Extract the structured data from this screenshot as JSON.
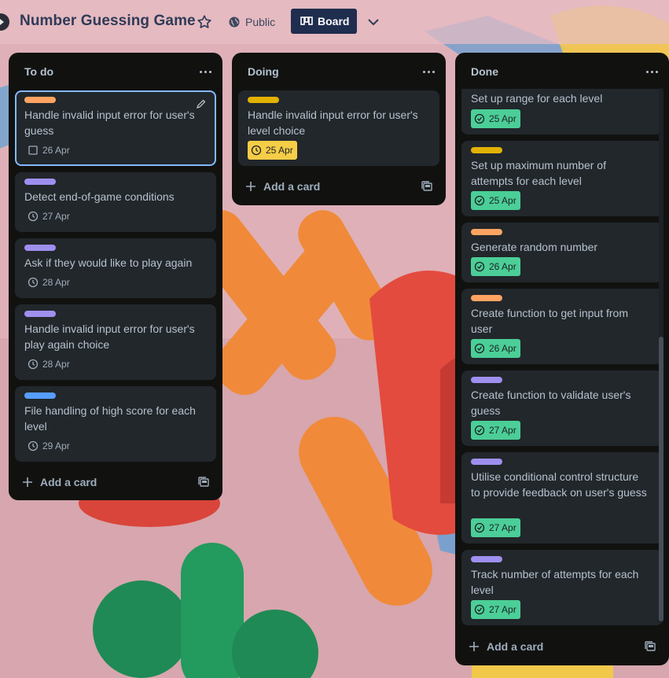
{
  "header": {
    "board_title": "Number Guessing Game",
    "visibility_label": "Public",
    "view_label": "Board"
  },
  "lists": {
    "todo": {
      "title": "To do",
      "add_label": "Add a card",
      "cards": [
        {
          "title": "Handle invalid input error for user's guess",
          "label_color": "#fea362",
          "date": "26 Apr",
          "badge": "plain"
        },
        {
          "title": "Detect end-of-game conditions",
          "label_color": "#9f8fef",
          "date": "27 Apr",
          "badge": "plain"
        },
        {
          "title": "Ask if they would like to play again",
          "label_color": "#9f8fef",
          "date": "28 Apr",
          "badge": "plain"
        },
        {
          "title": "Handle invalid input error for user's play again choice",
          "label_color": "#9f8fef",
          "date": "28 Apr",
          "badge": "plain"
        },
        {
          "title": "File handling of high score for each level",
          "label_color": "#579dff",
          "date": "29 Apr",
          "badge": "plain"
        }
      ]
    },
    "doing": {
      "title": "Doing",
      "add_label": "Add a card",
      "cards": [
        {
          "title": "Handle invalid input error for user's level choice",
          "label_color": "#e2b203",
          "date": "25 Apr",
          "badge": "yellow"
        }
      ]
    },
    "done": {
      "title": "Done",
      "add_label": "Add a card",
      "cards": [
        {
          "title": "Set up range for each level",
          "label_color": "",
          "date": "25 Apr",
          "badge": "green"
        },
        {
          "title": "Set up maximum number of attempts for each level",
          "label_color": "#e2b203",
          "date": "25 Apr",
          "badge": "green"
        },
        {
          "title": "Generate random number",
          "label_color": "#fea362",
          "date": "26 Apr",
          "badge": "green"
        },
        {
          "title": "Create function to get input from user",
          "label_color": "#fea362",
          "date": "26 Apr",
          "badge": "green"
        },
        {
          "title": "Create function to validate user's guess",
          "label_color": "#9f8fef",
          "date": "27 Apr",
          "badge": "green"
        },
        {
          "title": "Utilise conditional control structure to provide feedback on user's guess",
          "label_color": "#9f8fef",
          "date": "27 Apr",
          "badge": "green"
        },
        {
          "title": "Track number of attempts for each level",
          "label_color": "#9f8fef",
          "date": "27 Apr",
          "badge": "green"
        }
      ]
    }
  },
  "icons": {
    "clock": "clock-icon",
    "card": "card-description-icon",
    "plus": "plus-icon",
    "template": "card-template-icon",
    "menu": "more-options-icon"
  }
}
